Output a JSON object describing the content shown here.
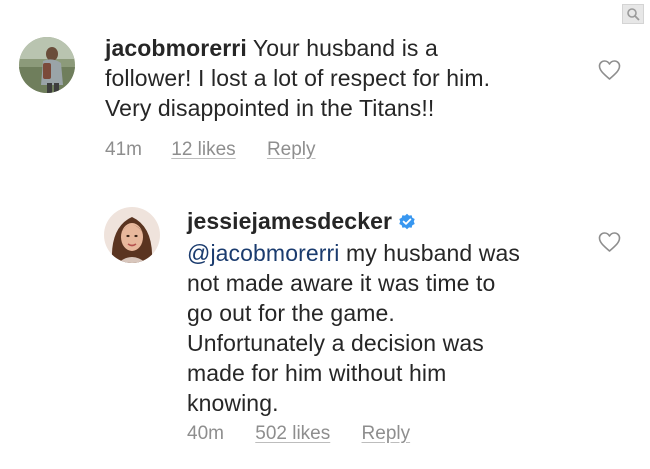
{
  "comments": [
    {
      "username": "jacobmorerri",
      "text": "Your husband is a follower! I lost a lot of respect for him. Very disappointed in the Titans!!",
      "line1": " Your husband is a",
      "line2": "follower! I lost a lot of respect for him.",
      "line3": "Very disappointed in the Titans!!",
      "time": "41m",
      "likes": "12 likes",
      "reply": "Reply"
    },
    {
      "username": "jessiejamesdecker",
      "verified": true,
      "mention": "@jacobmorerri",
      "line1": " my husband was",
      "line2": "not made aware it was time to",
      "line3": "go out for the game.",
      "line4": "Unfortunately a decision was",
      "line5": "made for him without him",
      "line6": "knowing.",
      "time": "40m",
      "likes": "502 likes",
      "reply": "Reply"
    }
  ],
  "colors": {
    "text": "#262626",
    "meta": "#8e8e8e",
    "mention": "#1a3b6e",
    "verified": "#3897f0",
    "heart": "#8e8e8e"
  },
  "icons": [
    "zoom-icon",
    "heart-icon",
    "verified-badge-icon"
  ]
}
